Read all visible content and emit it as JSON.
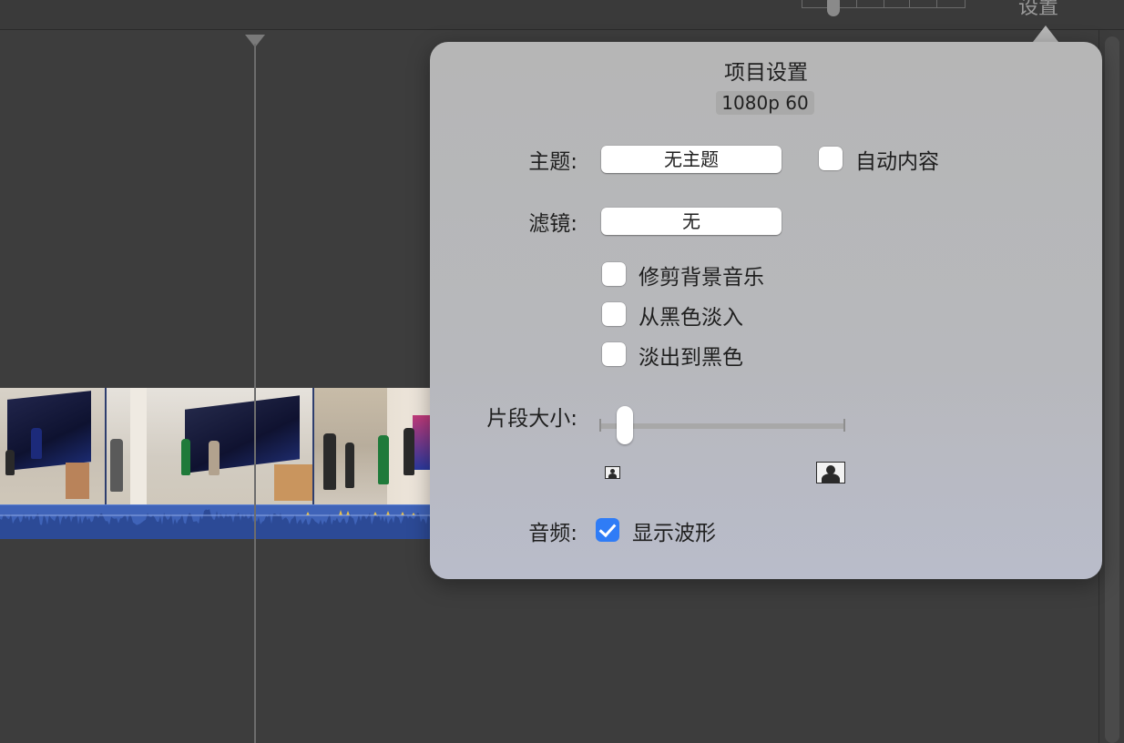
{
  "toolbar": {
    "settings_label": "设置"
  },
  "popover": {
    "title": "项目设置",
    "format": "1080p 60",
    "theme": {
      "label": "主题:",
      "value": "无主题",
      "auto_content_label": "自动内容",
      "auto_content_checked": false
    },
    "filter": {
      "label": "滤镜:",
      "value": "无"
    },
    "options": [
      {
        "label": "修剪背景音乐",
        "checked": false
      },
      {
        "label": "从黑色淡入",
        "checked": false
      },
      {
        "label": "淡出到黑色",
        "checked": false
      }
    ],
    "clip_size": {
      "label": "片段大小:",
      "level": 0.1
    },
    "audio": {
      "label": "音频:",
      "show_waveform_label": "显示波形",
      "show_waveform_checked": true
    }
  },
  "icons": {
    "small_size": "person-small-icon",
    "large_size": "person-large-icon",
    "playhead": "playhead-triangle-icon"
  }
}
